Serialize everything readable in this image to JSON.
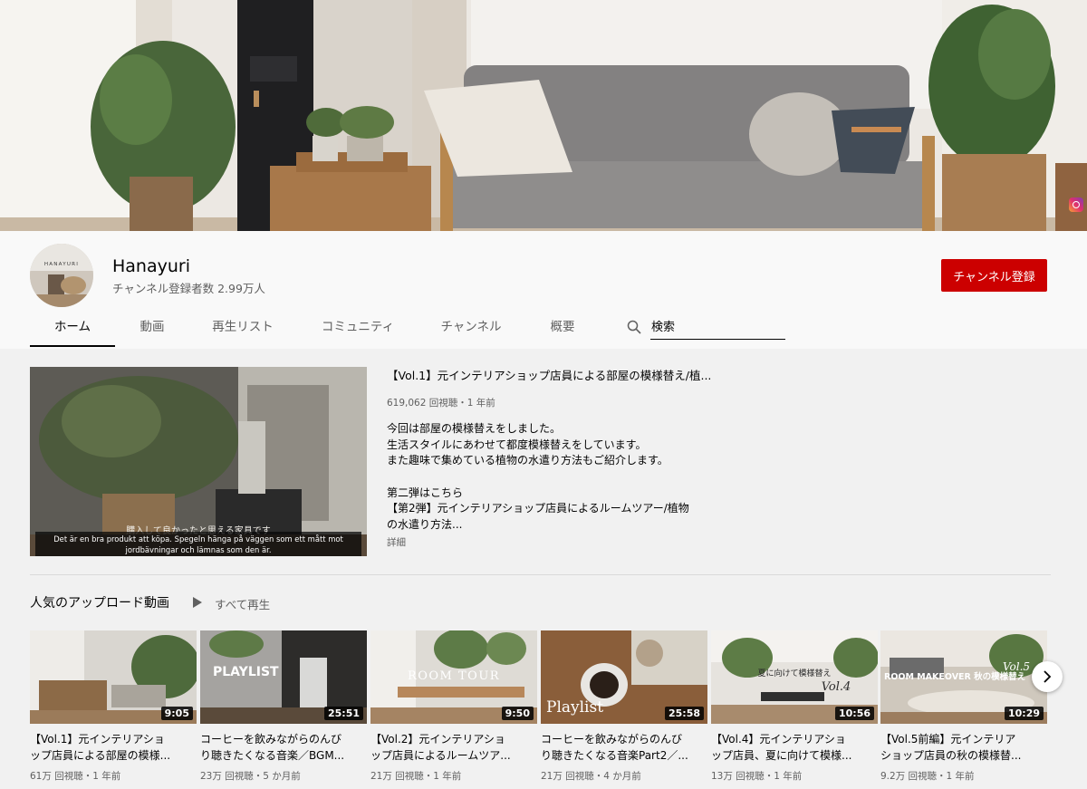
{
  "channel": {
    "name": "Hanayuri",
    "subscribers": "チャンネル登録者数 2.99万人",
    "avatar_text": "HANAYURI",
    "subscribe_label": "チャンネル登録"
  },
  "tabs": [
    "ホーム",
    "動画",
    "再生リスト",
    "コミュニティ",
    "チャンネル",
    "概要"
  ],
  "search": {
    "placeholder": "検索"
  },
  "featured": {
    "title": "【Vol.1】元インテリアショップ店員による部屋の模様替え/植...",
    "meta": "619,062 回視聴・1 年前",
    "description_lines": [
      "今回は部屋の模様替えをしました。",
      "生活スタイルにあわせて都度模様替えをしています。",
      "また趣味で集めている植物の水遣り方法もご紹介します。",
      "",
      "第二弾はこちら",
      "【第2弾】元インテリアショップ店員によるルームツアー/植物",
      "の水遣り方法..."
    ],
    "more_label": "詳細",
    "overlay_text": "購入して良かったと思える家具です",
    "caption_lines": [
      "Det är en bra produkt att köpa. Spegeln hänga på väggen som ett mått mot",
      "jordbävningar och lämnas som den är."
    ]
  },
  "shelf": {
    "title": "人気のアップロード動画",
    "play_all": "すべて再生",
    "videos": [
      {
        "title_lines": [
          "【Vol.1】元インテリアショ",
          "ップ店員による部屋の模様..."
        ],
        "duration": "9:05",
        "meta": "61万 回視聴・1 年前"
      },
      {
        "title_lines": [
          "コーヒーを飲みながらのんび",
          "り聴きたくなる音楽／BGM..."
        ],
        "duration": "25:51",
        "meta": "23万 回視聴・5 か月前",
        "thumb_text": "PLAYLIST"
      },
      {
        "title_lines": [
          "【Vol.2】元インテリアショ",
          "ップ店員によるルームツア..."
        ],
        "duration": "9:50",
        "meta": "21万 回視聴・1 年前",
        "thumb_text": "ROOM TOUR"
      },
      {
        "title_lines": [
          "コーヒーを飲みながらのんび",
          "り聴きたくなる音楽Part2／..."
        ],
        "duration": "25:58",
        "meta": "21万 回視聴・4 か月前",
        "thumb_text": "Playlist"
      },
      {
        "title_lines": [
          "【Vol.4】元インテリアショ",
          "ップ店員、夏に向けて模様..."
        ],
        "duration": "10:56",
        "meta": "13万 回視聴・1 年前",
        "thumb_text": "夏に向けて模様替え",
        "thumb_text2": "Vol.4"
      },
      {
        "title_lines": [
          "【Vol.5前編】元インテリア",
          "ショップ店員の秋の模様替..."
        ],
        "duration": "10:29",
        "meta": "9.2万 回視聴・1 年前",
        "thumb_text": "ROOM MAKEOVER 秋の模様替え",
        "thumb_text2": "Vol.5"
      }
    ]
  },
  "colors": {
    "subscribe": "#cc0000",
    "background": "#f9f9f9",
    "content_bg": "#f1f1f1",
    "instagram": "#e1306c"
  },
  "icons": [
    "instagram-icon",
    "search-icon",
    "play-all-icon",
    "chevron-right-icon"
  ]
}
